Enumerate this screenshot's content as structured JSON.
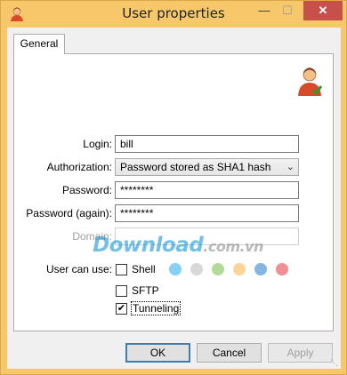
{
  "window": {
    "title": "User properties",
    "minimize_glyph": "—",
    "maximize_glyph": "☐",
    "close_glyph": "✕"
  },
  "tabs": [
    {
      "label": "General",
      "selected": true
    }
  ],
  "form": {
    "login_label": "Login:",
    "login_value": "bill",
    "authorization_label": "Authorization:",
    "authorization_value": "Password stored as SHA1 hash",
    "password_label": "Password:",
    "password_value": "********",
    "password_again_label": "Password (again):",
    "password_again_value": "********",
    "domain_label": "Domain:",
    "domain_value": "",
    "user_can_use_label": "User can use:"
  },
  "permissions": [
    {
      "label": "Shell",
      "checked": false
    },
    {
      "label": "SFTP",
      "checked": false
    },
    {
      "label": "Tunneling",
      "checked": true
    }
  ],
  "shell_color_dots": [
    "#86d0f2",
    "#d8d8d8",
    "#b2db9a",
    "#fad49a",
    "#85b6e0",
    "#f08f94"
  ],
  "watermark": {
    "main": "Download",
    "suffix": ".com.vn"
  },
  "buttons": {
    "ok": "OK",
    "cancel": "Cancel",
    "apply": "Apply"
  },
  "colors": {
    "titlebar": "#f6c86a",
    "close": "#c7504a",
    "default_button_border": "#3c7fb1"
  },
  "icons": {
    "app": "user-icon",
    "header": "user-icon"
  }
}
